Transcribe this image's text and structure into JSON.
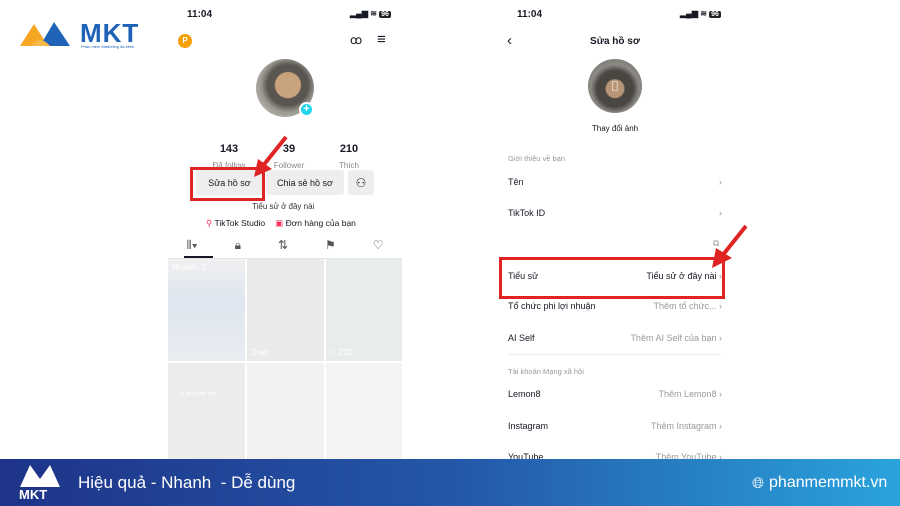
{
  "brand": {
    "logo_text": "MKT",
    "logo_sub": "Phần mềm Marketing đa kênh"
  },
  "left_phone": {
    "time": "11:04",
    "battery": "96",
    "stats": [
      {
        "value": "143",
        "label": "Đã follow"
      },
      {
        "value": "39",
        "label": "Follower"
      },
      {
        "value": "210",
        "label": "Thích"
      }
    ],
    "edit_profile": "Sửa hồ sơ",
    "share_profile": "Chia sẻ hồ sơ",
    "bio": "Tiểu sử ở đây nài",
    "studio": "TikTok Studio",
    "orders": "Đơn hàng của bạn",
    "tiles": [
      {
        "label": "Nhanh.. 2"
      },
      {
        "label": "Draft"
      },
      {
        "label": "▷ 232"
      },
      {
        "label": "Do going the bark"
      },
      {
        "label": ""
      },
      {
        "label": ""
      }
    ]
  },
  "right_phone": {
    "time": "11:04",
    "battery": "96",
    "title": "Sửa hồ sơ",
    "change_photo": "Thay đổi ảnh",
    "section_about": "Giới thiệu về bạn",
    "rows": [
      {
        "label": "Tên",
        "value": ""
      },
      {
        "label": "TikTok ID",
        "value": ""
      },
      {
        "label": "Tiểu sử",
        "value": "Tiểu sử ở đây nài"
      },
      {
        "label": "Tổ chức phi lợi nhuận",
        "value": "Thêm tổ chức..."
      },
      {
        "label": "AI Self",
        "value": "Thêm AI Self của bạn"
      }
    ],
    "section_social": "Tài khoản Mạng xã hội",
    "social": [
      {
        "label": "Lemon8",
        "value": "Thêm Lemon8"
      },
      {
        "label": "Instagram",
        "value": "Thêm Instagram"
      },
      {
        "label": "YouTube",
        "value": "Thêm YouTube"
      }
    ]
  },
  "banner": {
    "slogan": "Hiệu quả - Nhanh  - Dễ dùng",
    "website": "phanmemmkt.vn",
    "logo_text": "MKT"
  },
  "colors": {
    "highlight": "#e02424",
    "banner_start": "#1e3488",
    "banner_end": "#2aa3dc",
    "brand_blue": "#1f63b8",
    "brand_orange": "#f5a623"
  }
}
